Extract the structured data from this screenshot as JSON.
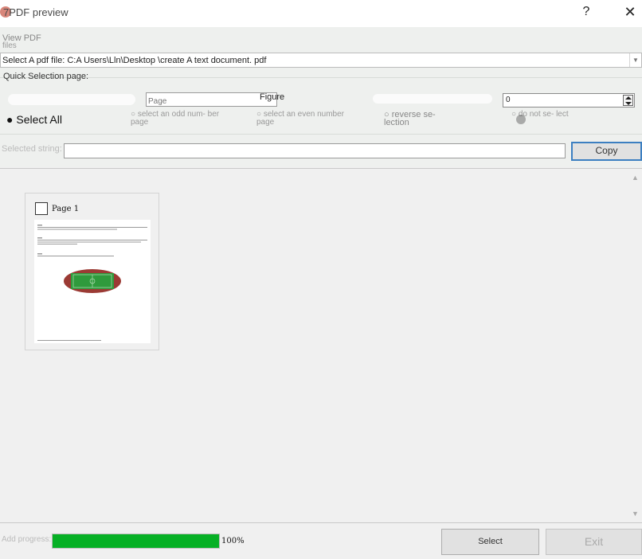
{
  "window": {
    "title": "7PDF preview",
    "help_label": "?",
    "close_label": "✕"
  },
  "file_section": {
    "view_pdf_label": "View PDF",
    "files_label": "files",
    "file_select_value": "Select A pdf file: C:A Users\\Lln\\Desktop \\create A text document. pdf",
    "dropdown_arrow": "▼"
  },
  "quick_selection": {
    "label": "Quick Selection page:",
    "page_range_placeholder": "Page",
    "figure_label": "Figure",
    "number_value": "0",
    "select_all": "Select All",
    "options": {
      "odd": "select an odd num- ber page",
      "even": "select an even number page",
      "reverse": "reverse se- lection",
      "none": "do not se- lect"
    }
  },
  "selected_string": {
    "label": "Selected string:",
    "value": "",
    "copy_label": "Copy"
  },
  "pages": [
    {
      "label": "Page 1",
      "checked": false
    }
  ],
  "progress": {
    "label": "Add progress:",
    "percent": 100,
    "percent_text": "100%",
    "fill_color": "#06b025"
  },
  "buttons": {
    "select_label": "Select",
    "exit_label": "Exit"
  }
}
